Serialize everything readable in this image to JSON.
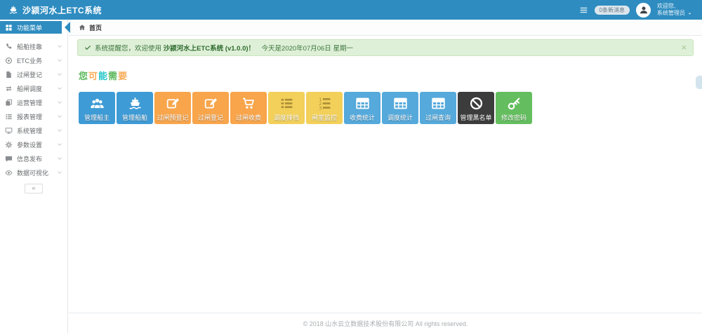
{
  "colors": {
    "header_bg": "#2e8cc0",
    "active_menu_bg": "#2e8cc0",
    "alert_bg": "#dff0d8",
    "alert_border": "#c8e5bc",
    "alert_text": "#3c763d"
  },
  "header": {
    "app_title": "沙颍河水上ETC系统",
    "badge_label": "0条新消息",
    "welcome_line1": "欢迎您,",
    "welcome_line2": "系统管理员"
  },
  "breadcrumb": {
    "home_label": "首页"
  },
  "alert": {
    "prefix": "系统提醒您，欢迎使用 ",
    "highlight": "沙颍河水上ETC系统 (v1.0.0)！",
    "suffix": "　今天是2020年07月06日 星期一",
    "close_glyph": "×"
  },
  "sidebar": {
    "items": [
      {
        "label": "功能菜单",
        "icon": "modules-icon",
        "active": true
      },
      {
        "label": "船舶挂靠",
        "icon": "phone-icon",
        "active": false
      },
      {
        "label": "ETC业务",
        "icon": "disc-icon",
        "active": false
      },
      {
        "label": "过闸登记",
        "icon": "file-icon",
        "active": false
      },
      {
        "label": "船闸调度",
        "icon": "exchange-icon",
        "active": false
      },
      {
        "label": "运营管理",
        "icon": "copy-icon",
        "active": false
      },
      {
        "label": "报表管理",
        "icon": "list-icon",
        "active": false
      },
      {
        "label": "系统管理",
        "icon": "desktop-icon",
        "active": false
      },
      {
        "label": "参数设置",
        "icon": "gear-icon",
        "active": false
      },
      {
        "label": "信息发布",
        "icon": "comment-icon",
        "active": false
      },
      {
        "label": "数据可视化",
        "icon": "eye-icon",
        "active": false
      }
    ],
    "collapse_glyph": "«"
  },
  "main": {
    "section_title": {
      "chars": [
        {
          "text": "您",
          "color": "#5cb85c"
        },
        {
          "text": "可",
          "color": "#f8ac59"
        },
        {
          "text": "能",
          "color": "#23c6c8"
        },
        {
          "text": "需",
          "color": "#5cb85c"
        },
        {
          "text": "要",
          "color": "#f8ac59"
        }
      ]
    },
    "tiles": [
      {
        "label": "管理船主",
        "icon": "users-icon",
        "color": "#3e9bd5",
        "icon_color": "#ffffff"
      },
      {
        "label": "管理船舶",
        "icon": "ship-icon",
        "color": "#3e9bd5",
        "icon_color": "#ffffff"
      },
      {
        "label": "过闸预登记",
        "icon": "edit-icon",
        "color": "#f8a54b",
        "icon_color": "#ffffff"
      },
      {
        "label": "过闸登记",
        "icon": "edit-icon",
        "color": "#f8a54b",
        "icon_color": "#ffffff"
      },
      {
        "label": "过闸收费",
        "icon": "cart-icon",
        "color": "#f8a54b",
        "icon_color": "#ffffff"
      },
      {
        "label": "调度排挡",
        "icon": "list-icon",
        "color": "#f2d05a",
        "icon_color": "#ab8d38"
      },
      {
        "label": "闸室监控",
        "icon": "list-ol-icon",
        "color": "#f2d05a",
        "icon_color": "#ab8d38"
      },
      {
        "label": "收费统计",
        "icon": "table-icon",
        "color": "#55a9db",
        "icon_color": "#ffffff"
      },
      {
        "label": "调度统计",
        "icon": "table-icon",
        "color": "#55a9db",
        "icon_color": "#ffffff"
      },
      {
        "label": "过闸查询",
        "icon": "table-icon",
        "color": "#55a9db",
        "icon_color": "#ffffff"
      },
      {
        "label": "管理黑名单",
        "icon": "ban-icon",
        "color": "#3c3c3c",
        "icon_color": "#ffffff"
      },
      {
        "label": "修改密码",
        "icon": "key-icon",
        "color": "#64be5f",
        "icon_color": "#ffffff"
      }
    ]
  },
  "footer": {
    "copyright": "© 2018 山水云立数据技术股份有限公司 All rights reserved."
  }
}
